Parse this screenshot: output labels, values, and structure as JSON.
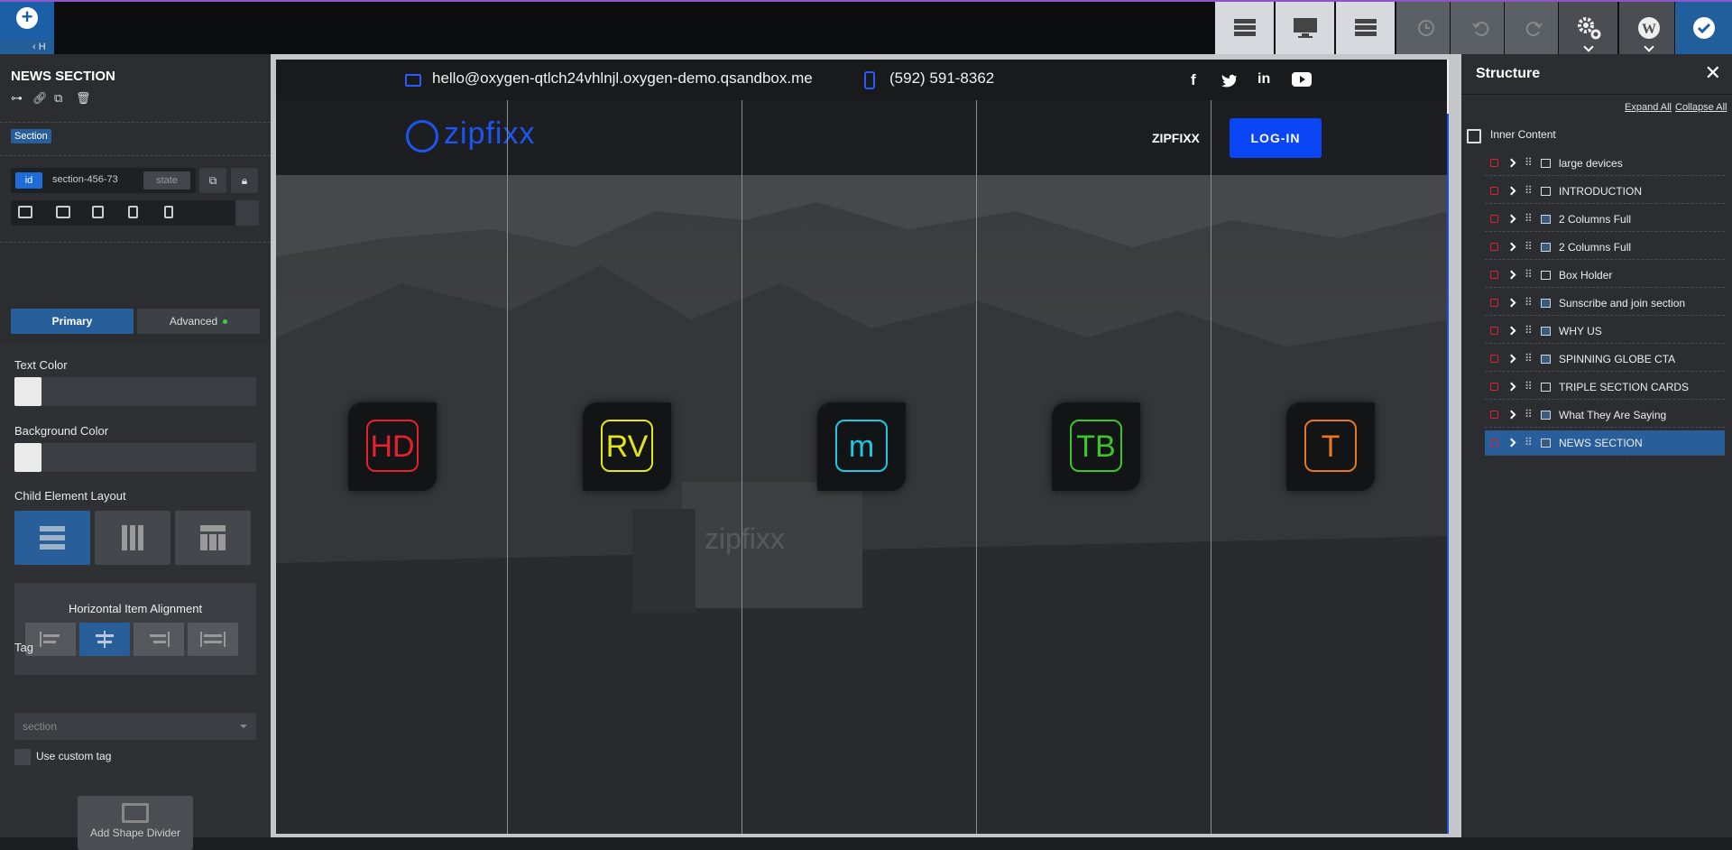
{
  "topbar": {
    "back_label": "H",
    "buttons": [
      {
        "name": "structure-icon"
      },
      {
        "name": "desktop-icon"
      },
      {
        "name": "layers-icon"
      },
      {
        "name": "history-icon"
      },
      {
        "name": "undo-icon"
      },
      {
        "name": "redo-icon"
      },
      {
        "name": "settings-icon"
      },
      {
        "name": "wordpress-icon"
      },
      {
        "name": "save-check-icon"
      }
    ]
  },
  "left_panel": {
    "title": "NEWS SECTION",
    "badge": "Section",
    "id_tag": "id",
    "id_value": "section-456-73",
    "state_label": "state",
    "tabs": {
      "primary": "Primary",
      "advanced": "Advanced"
    },
    "text_color_label": "Text Color",
    "background_color_label": "Background Color",
    "child_layout_label": "Child Element Layout",
    "horizontal_alignment_label": "Horizontal Item Alignment",
    "tag_label": "Tag",
    "tag_value": "section",
    "custom_tag_label": "Use custom tag",
    "shape_divider_label": "Add Shape Divider"
  },
  "canvas": {
    "email": "hello@oxygen-qtlch24vhlnjl.oxygen-demo.qsandbox.me",
    "phone": "(592) 591-8362",
    "social": [
      "f",
      "t",
      "in",
      "yt"
    ],
    "logo_text": "zipfixx",
    "nav_link": "ZIPFIXX",
    "login_button": "LOG-IN",
    "watermark": "zipfixx",
    "services": [
      {
        "label": "HD",
        "color": "#e8202e"
      },
      {
        "label": "RV",
        "color": "#e4e61a"
      },
      {
        "label": "m",
        "color": "#1fc6e6"
      },
      {
        "label": "TB",
        "color": "#3dc62b"
      },
      {
        "label": "T",
        "color": "#e8781e"
      }
    ]
  },
  "structure": {
    "title": "Structure",
    "expand_all": "Expand All",
    "collapse_all": "Collapse All",
    "root": "Inner Content",
    "items": [
      {
        "label": "large devices"
      },
      {
        "label": "INTRODUCTION"
      },
      {
        "label": "2 Columns Full"
      },
      {
        "label": "2 Columns Full"
      },
      {
        "label": "Box Holder"
      },
      {
        "label": "Sunscribe and join section"
      },
      {
        "label": "WHY US"
      },
      {
        "label": "SPINNING GLOBE CTA"
      },
      {
        "label": "TRIPLE SECTION CARDS"
      },
      {
        "label": "What They Are Saying"
      },
      {
        "label": "NEWS SECTION"
      }
    ]
  }
}
